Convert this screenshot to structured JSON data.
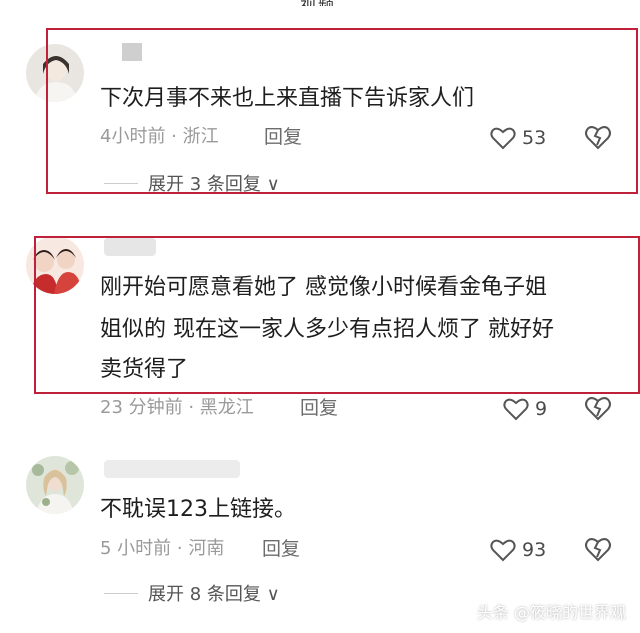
{
  "header": {
    "cut_title": "视频"
  },
  "comments": [
    {
      "avatar": "avatar-image",
      "text": "下次月事不来也上来直播下告诉家人们",
      "meta": "4小时前 · 浙江",
      "reply_label": "回复",
      "likes": "53",
      "expand_label": "展开 3 条回复 ∨"
    },
    {
      "avatar": "avatar-image",
      "text_lines": [
        "刚开始可愿意看她了  感觉像小时候看金龟子姐",
        "姐似的  现在这一家人多少有点招人烦了  就好好",
        "卖货得了"
      ],
      "meta": "23 分钟前 · 黑龙江",
      "reply_label": "回复",
      "likes": "9"
    },
    {
      "avatar": "avatar-image",
      "text": "不耽误123上链接。",
      "meta": "5 小时前 · 河南",
      "reply_label": "回复",
      "likes": "93",
      "expand_label": "展开 8 条回复 ∨"
    }
  ],
  "colors": {
    "highlight": "#c0213a",
    "meta": "#9a9a9a"
  },
  "icons": {
    "like": "heart-outline-icon",
    "dislike": "broken-heart-icon"
  },
  "watermark": "头条 @筱晓的世界观"
}
